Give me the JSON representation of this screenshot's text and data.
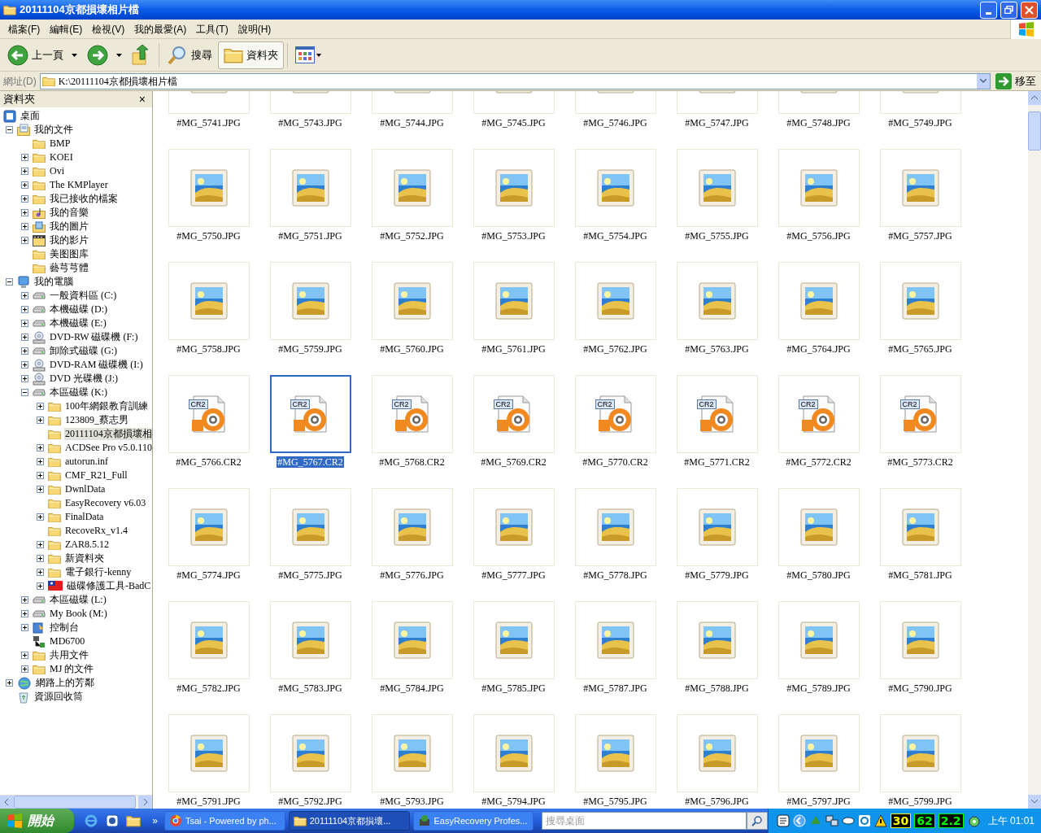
{
  "window": {
    "title": "20111104京都損壞相片檔"
  },
  "menu": [
    "檔案(F)",
    "編輯(E)",
    "檢視(V)",
    "我的最愛(A)",
    "工具(T)",
    "說明(H)"
  ],
  "toolbar": [
    {
      "kind": "back",
      "label": "上一頁",
      "pressed": false
    },
    {
      "kind": "forward",
      "pressed": false
    },
    {
      "kind": "up",
      "pressed": false
    },
    {
      "kind": "search",
      "label": "搜尋",
      "pressed": false
    },
    {
      "kind": "folders",
      "label": "資料夾",
      "pressed": true
    },
    {
      "kind": "views",
      "pressed": false
    }
  ],
  "address": {
    "label": "網址(D)",
    "value": "K:\\20111104京都損壞相片檔",
    "go": "移至"
  },
  "folders_pane": {
    "title": "資料夾",
    "close": "×",
    "tree": [
      {
        "label": "桌面",
        "kind": "desktop",
        "selected": false,
        "children": [
          {
            "label": "我的文件",
            "kind": "mydocs",
            "expanded": true,
            "selected": false,
            "children": [
              {
                "label": "BMP",
                "kind": "folder",
                "selected": false
              },
              {
                "label": "KOEI",
                "kind": "folder",
                "expanded": false,
                "selected": false
              },
              {
                "label": "Ovi",
                "kind": "folder",
                "expanded": false,
                "selected": false
              },
              {
                "label": "The KMPlayer",
                "kind": "folder",
                "expanded": false,
                "selected": false
              },
              {
                "label": "我已接收的檔案",
                "kind": "folder",
                "expanded": false,
                "selected": false
              },
              {
                "label": "我的音樂",
                "kind": "music",
                "expanded": false,
                "selected": false
              },
              {
                "label": "我的圖片",
                "kind": "pictures",
                "expanded": false,
                "selected": false
              },
              {
                "label": "我的影片",
                "kind": "video",
                "expanded": false,
                "selected": false
              },
              {
                "label": "美图图库",
                "kind": "folder",
                "selected": false
              },
              {
                "label": "藝芎芎體",
                "kind": "folder",
                "selected": false
              }
            ]
          },
          {
            "label": "我的電腦",
            "kind": "computer",
            "expanded": true,
            "selected": false,
            "children": [
              {
                "label": "一般資料區 (C:)",
                "kind": "drive",
                "expanded": false,
                "selected": false
              },
              {
                "label": "本機磁碟 (D:)",
                "kind": "drive",
                "expanded": false,
                "selected": false
              },
              {
                "label": "本機磁碟 (E:)",
                "kind": "drive",
                "expanded": false,
                "selected": false
              },
              {
                "label": "DVD-RW 磁碟機 (F:)",
                "kind": "cdrom",
                "expanded": false,
                "selected": false
              },
              {
                "label": "卸除式磁碟 (G:)",
                "kind": "drive",
                "expanded": false,
                "selected": false
              },
              {
                "label": "DVD-RAM 磁碟機 (I:)",
                "kind": "cdrom",
                "expanded": false,
                "selected": false
              },
              {
                "label": "DVD 光碟機 (J:)",
                "kind": "cdrom",
                "expanded": false,
                "selected": false
              },
              {
                "label": "本區磁碟 (K:)",
                "kind": "drive",
                "expanded": true,
                "selected": false,
                "children": [
                  {
                    "label": "100年網銀教育訓練",
                    "kind": "folder",
                    "expanded": false,
                    "selected": false
                  },
                  {
                    "label": "123809_蔡志男",
                    "kind": "folder",
                    "expanded": false,
                    "selected": false
                  },
                  {
                    "label": "20111104京都損壞相",
                    "kind": "folder",
                    "selected": true
                  },
                  {
                    "label": "ACDSee Pro v5.0.110",
                    "kind": "folder",
                    "expanded": false,
                    "selected": false
                  },
                  {
                    "label": "autorun.inf",
                    "kind": "folder",
                    "expanded": false,
                    "selected": false
                  },
                  {
                    "label": "CMF_R21_Full",
                    "kind": "folder",
                    "expanded": false,
                    "selected": false
                  },
                  {
                    "label": "DwnlData",
                    "kind": "folder",
                    "expanded": false,
                    "selected": false
                  },
                  {
                    "label": "EasyRecovery  v6.03",
                    "kind": "folder",
                    "selected": false
                  },
                  {
                    "label": "FinalData",
                    "kind": "folder",
                    "expanded": false,
                    "selected": false
                  },
                  {
                    "label": "RecoveRx_v1.4",
                    "kind": "folder",
                    "selected": false
                  },
                  {
                    "label": "ZAR8.5.12",
                    "kind": "folder",
                    "expanded": false,
                    "selected": false
                  },
                  {
                    "label": "新資料夾",
                    "kind": "folder",
                    "expanded": false,
                    "selected": false
                  },
                  {
                    "label": "電子銀行-kenny",
                    "kind": "folder",
                    "expanded": false,
                    "selected": false
                  },
                  {
                    "label": "磁碟修護工具-BadC",
                    "kind": "flag",
                    "expanded": false,
                    "selected": false
                  }
                ]
              },
              {
                "label": "本區磁碟 (L:)",
                "kind": "drive",
                "expanded": false,
                "selected": false
              },
              {
                "label": "My Book (M:)",
                "kind": "drive",
                "expanded": false,
                "selected": false
              },
              {
                "label": "控制台",
                "kind": "control",
                "expanded": false,
                "selected": false
              },
              {
                "label": "MD6700",
                "kind": "netdrive",
                "selected": false
              },
              {
                "label": "共用文件",
                "kind": "folder",
                "expanded": false,
                "selected": false
              },
              {
                "label": "MJ 的文件",
                "kind": "folder",
                "expanded": false,
                "selected": false
              }
            ]
          },
          {
            "label": "網路上的芳鄰",
            "kind": "network",
            "expanded": false,
            "selected": false
          },
          {
            "label": "資源回收筒",
            "kind": "recycle",
            "selected": false
          }
        ]
      }
    ]
  },
  "files": [
    {
      "name": "#MG_5741.JPG",
      "kind": "jpg",
      "selected": false
    },
    {
      "name": "#MG_5743.JPG",
      "kind": "jpg",
      "selected": false
    },
    {
      "name": "#MG_5744.JPG",
      "kind": "jpg",
      "selected": false
    },
    {
      "name": "#MG_5745.JPG",
      "kind": "jpg",
      "selected": false
    },
    {
      "name": "#MG_5746.JPG",
      "kind": "jpg",
      "selected": false
    },
    {
      "name": "#MG_5747.JPG",
      "kind": "jpg",
      "selected": false
    },
    {
      "name": "#MG_5748.JPG",
      "kind": "jpg",
      "selected": false
    },
    {
      "name": "#MG_5749.JPG",
      "kind": "jpg",
      "selected": false
    },
    {
      "name": "#MG_5750.JPG",
      "kind": "jpg",
      "selected": false
    },
    {
      "name": "#MG_5751.JPG",
      "kind": "jpg",
      "selected": false
    },
    {
      "name": "#MG_5752.JPG",
      "kind": "jpg",
      "selected": false
    },
    {
      "name": "#MG_5753.JPG",
      "kind": "jpg",
      "selected": false
    },
    {
      "name": "#MG_5754.JPG",
      "kind": "jpg",
      "selected": false
    },
    {
      "name": "#MG_5755.JPG",
      "kind": "jpg",
      "selected": false
    },
    {
      "name": "#MG_5756.JPG",
      "kind": "jpg",
      "selected": false
    },
    {
      "name": "#MG_5757.JPG",
      "kind": "jpg",
      "selected": false
    },
    {
      "name": "#MG_5758.JPG",
      "kind": "jpg",
      "selected": false
    },
    {
      "name": "#MG_5759.JPG",
      "kind": "jpg",
      "selected": false
    },
    {
      "name": "#MG_5760.JPG",
      "kind": "jpg",
      "selected": false
    },
    {
      "name": "#MG_5761.JPG",
      "kind": "jpg",
      "selected": false
    },
    {
      "name": "#MG_5762.JPG",
      "kind": "jpg",
      "selected": false
    },
    {
      "name": "#MG_5763.JPG",
      "kind": "jpg",
      "selected": false
    },
    {
      "name": "#MG_5764.JPG",
      "kind": "jpg",
      "selected": false
    },
    {
      "name": "#MG_5765.JPG",
      "kind": "jpg",
      "selected": false
    },
    {
      "name": "#MG_5766.CR2",
      "kind": "cr2",
      "badge": "CR2",
      "selected": false
    },
    {
      "name": "#MG_5767.CR2",
      "kind": "cr2",
      "badge": "CR2",
      "selected": true
    },
    {
      "name": "#MG_5768.CR2",
      "kind": "cr2",
      "badge": "CR2",
      "selected": false
    },
    {
      "name": "#MG_5769.CR2",
      "kind": "cr2",
      "badge": "CR2",
      "selected": false
    },
    {
      "name": "#MG_5770.CR2",
      "kind": "cr2",
      "badge": "CR2",
      "selected": false
    },
    {
      "name": "#MG_5771.CR2",
      "kind": "cr2",
      "badge": "CR2",
      "selected": false
    },
    {
      "name": "#MG_5772.CR2",
      "kind": "cr2",
      "badge": "CR2",
      "selected": false
    },
    {
      "name": "#MG_5773.CR2",
      "kind": "cr2",
      "badge": "CR2",
      "selected": false
    },
    {
      "name": "#MG_5774.JPG",
      "kind": "jpg",
      "selected": false
    },
    {
      "name": "#MG_5775.JPG",
      "kind": "jpg",
      "selected": false
    },
    {
      "name": "#MG_5776.JPG",
      "kind": "jpg",
      "selected": false
    },
    {
      "name": "#MG_5777.JPG",
      "kind": "jpg",
      "selected": false
    },
    {
      "name": "#MG_5778.JPG",
      "kind": "jpg",
      "selected": false
    },
    {
      "name": "#MG_5779.JPG",
      "kind": "jpg",
      "selected": false
    },
    {
      "name": "#MG_5780.JPG",
      "kind": "jpg",
      "selected": false
    },
    {
      "name": "#MG_5781.JPG",
      "kind": "jpg",
      "selected": false
    },
    {
      "name": "#MG_5782.JPG",
      "kind": "jpg",
      "selected": false
    },
    {
      "name": "#MG_5783.JPG",
      "kind": "jpg",
      "selected": false
    },
    {
      "name": "#MG_5784.JPG",
      "kind": "jpg",
      "selected": false
    },
    {
      "name": "#MG_5785.JPG",
      "kind": "jpg",
      "selected": false
    },
    {
      "name": "#MG_5787.JPG",
      "kind": "jpg",
      "selected": false
    },
    {
      "name": "#MG_5788.JPG",
      "kind": "jpg",
      "selected": false
    },
    {
      "name": "#MG_5789.JPG",
      "kind": "jpg",
      "selected": false
    },
    {
      "name": "#MG_5790.JPG",
      "kind": "jpg",
      "selected": false
    },
    {
      "name": "#MG_5791.JPG",
      "kind": "jpg",
      "selected": false
    },
    {
      "name": "#MG_5792.JPG",
      "kind": "jpg",
      "selected": false
    },
    {
      "name": "#MG_5793.JPG",
      "kind": "jpg",
      "selected": false
    },
    {
      "name": "#MG_5794.JPG",
      "kind": "jpg",
      "selected": false
    },
    {
      "name": "#MG_5795.JPG",
      "kind": "jpg",
      "selected": false
    },
    {
      "name": "#MG_5796.JPG",
      "kind": "jpg",
      "selected": false
    },
    {
      "name": "#MG_5797.JPG",
      "kind": "jpg",
      "selected": false
    },
    {
      "name": "#MG_5799.JPG",
      "kind": "jpg",
      "selected": false
    }
  ],
  "taskbar": {
    "start": "開始",
    "more": "»",
    "tasks": [
      {
        "label": "Tsai - Powered by ph...",
        "kind": "browser",
        "selected": false
      },
      {
        "label": "20111104京都損壞...",
        "kind": "folder",
        "selected": true
      },
      {
        "label": "EasyRecovery Profes...",
        "kind": "app",
        "selected": false
      }
    ],
    "search": {
      "placeholder": "搜尋桌面"
    },
    "readings": [
      {
        "text": "30",
        "color": "#ffff00"
      },
      {
        "text": "62",
        "color": "#00ff00"
      },
      {
        "text": "2.2",
        "color": "#00ff00"
      }
    ],
    "clock": "上午 01:01"
  }
}
